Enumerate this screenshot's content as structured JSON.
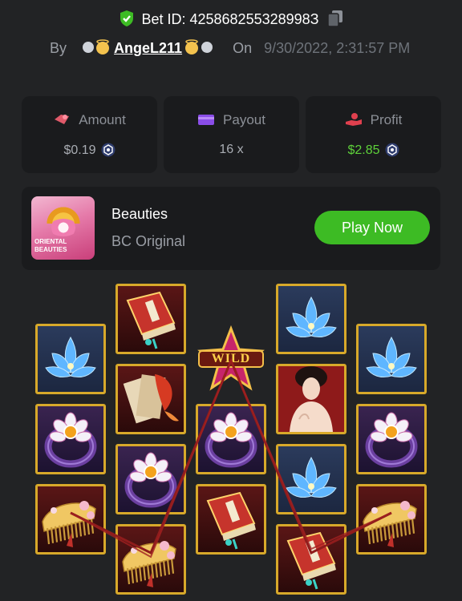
{
  "bet": {
    "id_label": "Bet ID: 425868255328998З",
    "by_label": "By",
    "username": "AngeL211",
    "on_label": "On",
    "date": "9/30/2022, 2:31:57 PM"
  },
  "stats": {
    "amount": {
      "label": "Amount",
      "value": "$0.19"
    },
    "payout": {
      "label": "Payout",
      "value": "16 x"
    },
    "profit": {
      "label": "Profit",
      "value": "$2.85"
    }
  },
  "game": {
    "title": "Beauties",
    "subtitle": "BC Original",
    "play_label": "Play Now",
    "thumb_text": "ORIENTAL BEAUTIES"
  },
  "reels": {
    "symbol_names": [
      "book",
      "lotus",
      "ring",
      "comb",
      "koi",
      "wild",
      "lady"
    ],
    "grid": [
      [
        "lotus",
        "ring",
        "comb"
      ],
      [
        "book",
        "koi",
        "ring",
        "comb"
      ],
      [
        "wild",
        "ring",
        "book"
      ],
      [
        "lotus",
        "lady",
        "lotus",
        "book"
      ],
      [
        "lotus",
        "ring",
        "comb"
      ]
    ],
    "wild_text": "WILD"
  },
  "colors": {
    "background": "#222325",
    "card": "#1a1b1d",
    "accent_green": "#3dbb24",
    "profit_green": "#5ed23a",
    "reel_border": "#d8a92a",
    "payline": "#8f1c1c"
  }
}
